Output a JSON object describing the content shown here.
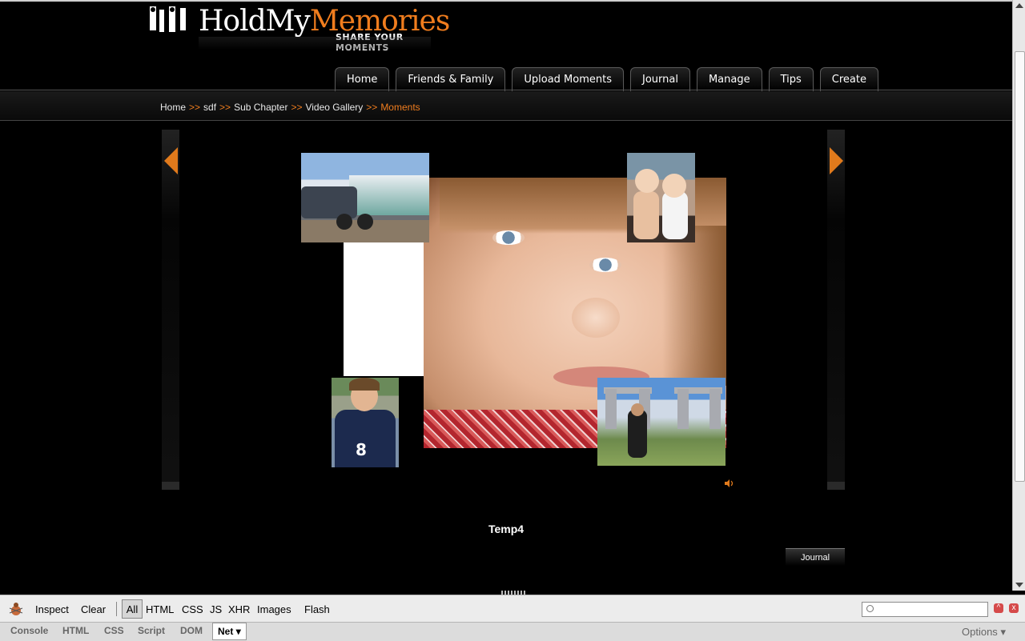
{
  "logo": {
    "brand_a": "Hold",
    "brand_b": "My",
    "brand_c": "Memories",
    "tagline": "SHARE YOUR MOMENTS"
  },
  "nav": {
    "tabs": [
      "Home",
      "Friends & Family",
      "Upload Moments",
      "Journal",
      "Manage",
      "Tips",
      "Create"
    ]
  },
  "breadcrumb": {
    "items": [
      "Home",
      "sdf",
      "Sub Chapter",
      "Video Gallery"
    ],
    "separator": ">>",
    "current": "Moments"
  },
  "slideshow": {
    "title": "Temp4",
    "journal_label": "Journal"
  },
  "firebug": {
    "toolbar": [
      "Inspect",
      "Clear",
      "All",
      "HTML",
      "CSS",
      "JS",
      "XHR",
      "Images",
      "Flash"
    ],
    "panels": [
      "Console",
      "HTML",
      "CSS",
      "Script",
      "DOM",
      "Net"
    ],
    "options_label": "Options",
    "search_value": ""
  },
  "colors": {
    "accent": "#f07d1e",
    "background": "#000000"
  }
}
